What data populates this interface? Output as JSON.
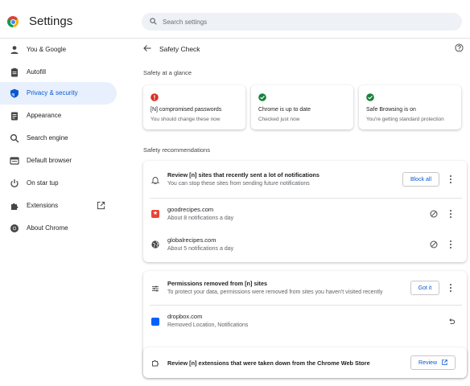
{
  "app": {
    "title": "Settings"
  },
  "search": {
    "placeholder": "Search settings",
    "value": ""
  },
  "sidebar": {
    "items": [
      {
        "label": "You & Google",
        "icon": "person-icon",
        "active": false
      },
      {
        "label": "Autofill",
        "icon": "clipboard-icon",
        "active": false
      },
      {
        "label": "Privacy & security",
        "icon": "shield-icon",
        "active": true
      },
      {
        "label": "Appearance",
        "icon": "palette-icon",
        "active": false
      },
      {
        "label": "Search engine",
        "icon": "search-icon",
        "active": false
      },
      {
        "label": "Default browser",
        "icon": "browser-icon",
        "active": false
      },
      {
        "label": "On star  tup",
        "icon": "power-icon",
        "active": false
      },
      {
        "label": "Extensions",
        "icon": "puzzle-icon",
        "active": false
      },
      {
        "label": "About Chrome",
        "icon": "chrome-icon",
        "active": false
      }
    ]
  },
  "page": {
    "title": "Safety Check",
    "glance_heading": "Safety at a glance",
    "glance_cards": [
      {
        "title": "[N] compromised passwords",
        "subtitle": "You should change these now",
        "status": "error",
        "color": "#d93025"
      },
      {
        "title": "Chrome is up to date",
        "subtitle": "Checked just now",
        "status": "ok",
        "color": "#188038"
      },
      {
        "title": "Safe Browsing is on",
        "subtitle": "You're getting standard protection",
        "status": "ok",
        "color": "#188038"
      }
    ],
    "recommendations_heading": "Safety recommendations",
    "notifications_card": {
      "title": "Review [n] sites that recently sent a lot of notifications",
      "subtitle": "You can stop these sites from sending future notifications",
      "action_label": "Block all",
      "sites": [
        {
          "name": "goodrecipes.com",
          "detail": "About 8 notifications a day",
          "favicon": "red"
        },
        {
          "name": "globalrecipes.com",
          "detail": "About 5 notifications a day",
          "favicon": "globe"
        }
      ]
    },
    "permissions_card": {
      "title": "Permissions removed from [n] sites",
      "subtitle": "To protect your data, permissions were removed from sites you haven't visited recently",
      "action_label": "Got it",
      "sites": [
        {
          "name": "dropbox.com",
          "detail": "Removed Location, Notifications",
          "favicon": "blue"
        }
      ]
    },
    "extensions_card": {
      "title": "Review [n] extensions that were taken down from the Chrome Web Store",
      "action_label": "Review"
    }
  },
  "colors": {
    "accent": "#0b57d0",
    "active_bg": "#e8f0fe",
    "error": "#d93025",
    "success": "#188038"
  }
}
